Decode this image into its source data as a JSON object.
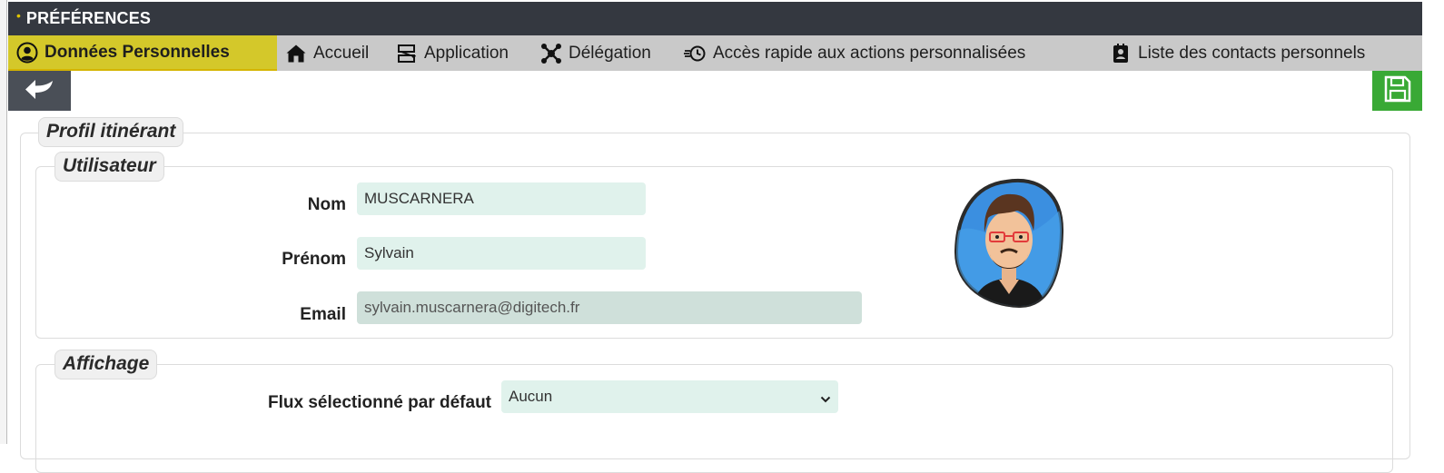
{
  "window": {
    "title": "PRÉFÉRENCES",
    "title_marker": "•"
  },
  "tabs": [
    {
      "label": "Données Personnelles",
      "icon": "user-circle-icon",
      "active": true
    },
    {
      "label": "Accueil",
      "icon": "home-icon",
      "active": false
    },
    {
      "label": "Application",
      "icon": "application-icon",
      "active": false
    },
    {
      "label": "Délégation",
      "icon": "delegation-icon",
      "active": false
    },
    {
      "label": "Accès rapide aux actions personnalisées",
      "icon": "quick-actions-icon",
      "active": false
    },
    {
      "label": "Liste des contacts personnels",
      "icon": "contacts-icon",
      "active": false
    }
  ],
  "toolbar": {
    "back_icon": "back-arrow-icon",
    "save_icon": "save-icon"
  },
  "profile": {
    "legend": "Profil itinérant",
    "user_section": {
      "legend": "Utilisateur",
      "fields": {
        "nom": {
          "label": "Nom",
          "value": "MUSCARNERA"
        },
        "prenom": {
          "label": "Prénom",
          "value": "Sylvain"
        },
        "email": {
          "label": "Email",
          "value": "sylvain.muscarnera@digitech.fr"
        }
      },
      "avatar": "avatar-icon"
    },
    "display_section": {
      "legend": "Affichage",
      "flux": {
        "label": "Flux sélectionné par défaut",
        "value": "Aucun"
      }
    }
  },
  "colors": {
    "titlebar": "#343840",
    "tabbar": "#c9c9c9",
    "active_tab": "#d4c82a",
    "back_button": "#4a4f57",
    "save_button": "#39a935",
    "input_bg": "#e0f2ec"
  }
}
